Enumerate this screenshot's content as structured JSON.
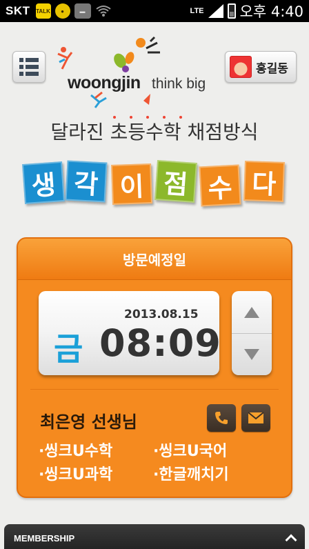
{
  "status_bar": {
    "carrier": "SKT",
    "notif_talk": "TALK",
    "network": "LTE",
    "time": "오후 4:40"
  },
  "header": {
    "logo_brand": "woongjin",
    "logo_tagline": "think big",
    "user_name": "홍길동"
  },
  "promo": {
    "subtitle": "달라진 초등수학 채점방식",
    "tiles": [
      {
        "char": "생",
        "color": "#1b8fd0"
      },
      {
        "char": "각",
        "color": "#1b8fd0"
      },
      {
        "char": "이",
        "color": "#f28a1c"
      },
      {
        "char": "점",
        "color": "#8cb82b"
      },
      {
        "char": "수",
        "color": "#f28a1c"
      },
      {
        "char": "다",
        "color": "#f28a1c"
      }
    ]
  },
  "visit": {
    "title": "방문예정일",
    "date": "2013.08.15",
    "day": "금",
    "time": "08:09",
    "teacher": "최은영 선생님",
    "subjects": [
      "·씽크U수학",
      "·씽크U국어",
      "·씽크U과학",
      "·한글깨치기"
    ]
  },
  "footer": {
    "membership": "MEMBERSHIP"
  },
  "colors": {
    "accent_orange": "#f58a1f",
    "day_blue": "#1ba0d8"
  }
}
